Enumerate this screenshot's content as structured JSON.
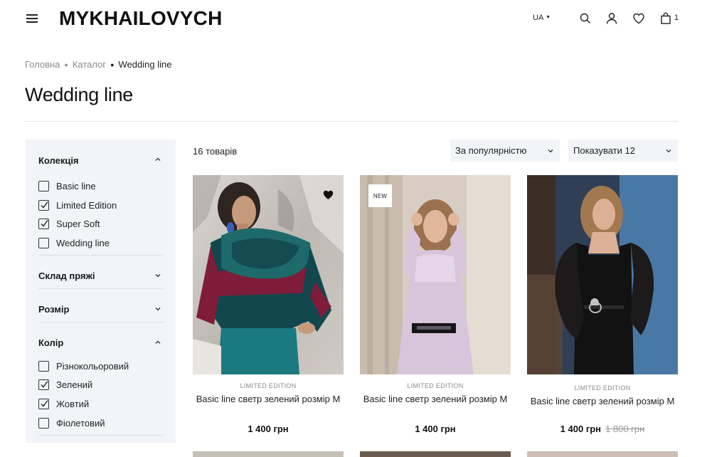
{
  "header": {
    "logo": "MYKHAILOVYCH",
    "lang": "UA",
    "icons": [
      "menu-icon",
      "search-icon",
      "user-icon",
      "heart-icon",
      "bag-icon"
    ],
    "cart_count": "1"
  },
  "breadcrumb": {
    "items": [
      "Головна",
      "Каталог",
      "Wedding line"
    ]
  },
  "page_title": "Wedding line",
  "toolbar": {
    "count_text": "16 товарів",
    "sort_value": "За популярністю",
    "per_page_value": "Показувати 12"
  },
  "filters": [
    {
      "title": "Колекція",
      "expanded": true,
      "options": [
        {
          "label": "Basic line",
          "checked": false
        },
        {
          "label": "Limited Edition",
          "checked": true
        },
        {
          "label": "Super Soft",
          "checked": true
        },
        {
          "label": "Wedding line",
          "checked": false
        }
      ]
    },
    {
      "title": "Склад пряжі",
      "expanded": false,
      "options": []
    },
    {
      "title": "Розмір",
      "expanded": false,
      "options": []
    },
    {
      "title": "Колір",
      "expanded": true,
      "options": [
        {
          "label": "Різнокольоровий",
          "checked": false
        },
        {
          "label": "Зелений",
          "checked": true
        },
        {
          "label": "Жовтий",
          "checked": true
        },
        {
          "label": "Фіолетовий",
          "checked": false
        }
      ]
    }
  ],
  "products": [
    {
      "badge": "",
      "favorited": true,
      "collection": "LIMITED EDITION",
      "name": "Basic line светр зелений розмір M",
      "price": "1 400 грн",
      "old_price": ""
    },
    {
      "badge": "NEW",
      "favorited": false,
      "collection": "LIMITED EDITION",
      "name": "Basic line светр зелений розмір M",
      "price": "1 400 грн",
      "old_price": ""
    },
    {
      "badge": "",
      "favorited": false,
      "collection": "LIMITED EDITION",
      "name": "Basic line светр зелений розмір M",
      "price": "1 400 грн",
      "old_price": "1 800 грн"
    }
  ],
  "colors": {
    "sidebar_bg": "#f2f4f8",
    "text": "#1a1a1a",
    "muted": "#8a8a8a"
  }
}
